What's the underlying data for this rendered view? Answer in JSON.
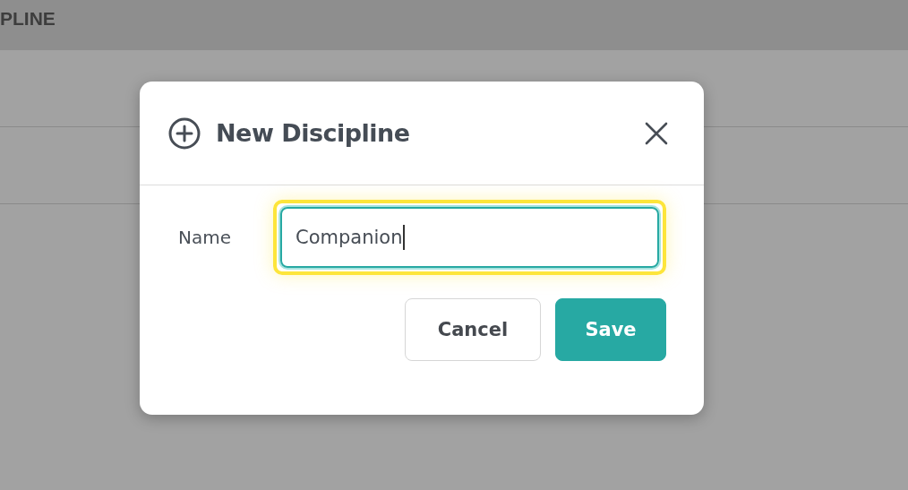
{
  "page": {
    "heading": "PLINE"
  },
  "dialog": {
    "title": "New Discipline",
    "field": {
      "label": "Name",
      "value": "Companion",
      "focused": true
    },
    "buttons": [
      {
        "label": "Cancel",
        "kind": "secondary"
      },
      {
        "label": "Save",
        "kind": "primary"
      }
    ]
  }
}
